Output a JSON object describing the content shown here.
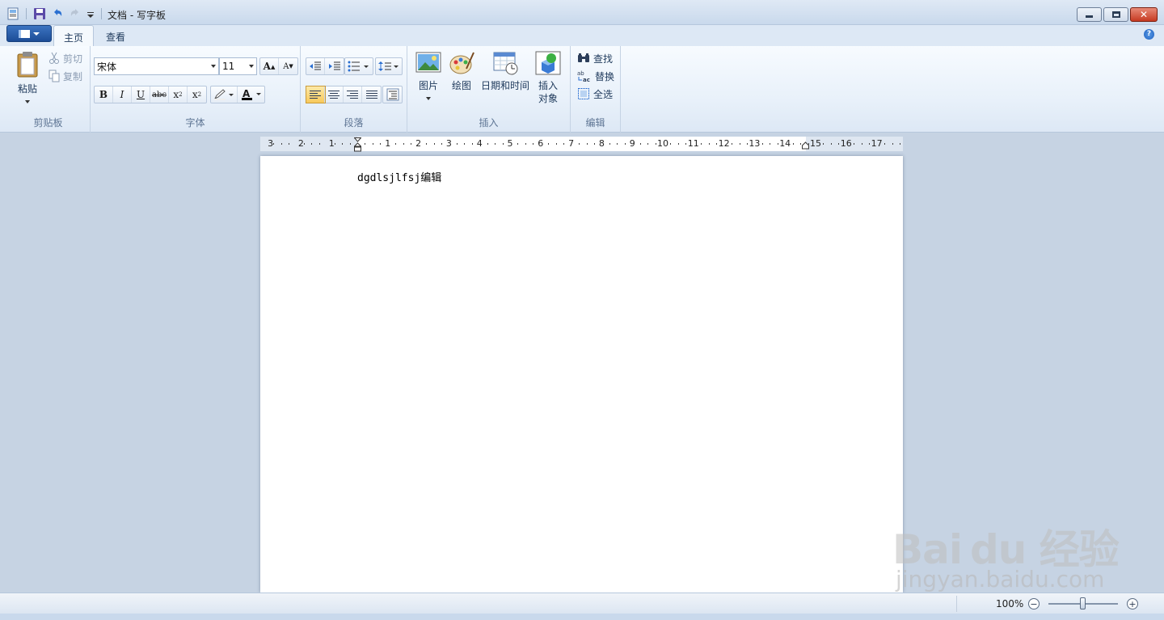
{
  "window": {
    "title": "文档 - 写字板"
  },
  "tabs": [
    {
      "label": "主页"
    },
    {
      "label": "查看"
    }
  ],
  "ribbon": {
    "clipboard": {
      "group_label": "剪贴板",
      "paste": "粘贴",
      "cut": "剪切",
      "copy": "复制"
    },
    "font": {
      "group_label": "字体",
      "font_name": "宋体",
      "font_size": "11"
    },
    "paragraph": {
      "group_label": "段落"
    },
    "insert": {
      "group_label": "插入",
      "picture": "图片",
      "paint": "绘图",
      "datetime": "日期和时间",
      "object_line1": "插入",
      "object_line2": "对象"
    },
    "editing": {
      "group_label": "编辑",
      "find": "查找",
      "replace": "替换",
      "select_all": "全选"
    }
  },
  "ruler": {
    "left_labels": [
      "3",
      "2",
      "1"
    ],
    "right_labels": [
      "1",
      "2",
      "3",
      "4",
      "5",
      "6",
      "7",
      "8",
      "9",
      "10",
      "11",
      "12",
      "13",
      "14",
      "15",
      "16",
      "17"
    ]
  },
  "document": {
    "text": "dgdlsjlfsj编辑"
  },
  "statusbar": {
    "zoom": "100%",
    "zoom_value_percent": 100
  },
  "watermark": {
    "logo": "Bai du 经验",
    "url": "jingyan.baidu.com"
  }
}
